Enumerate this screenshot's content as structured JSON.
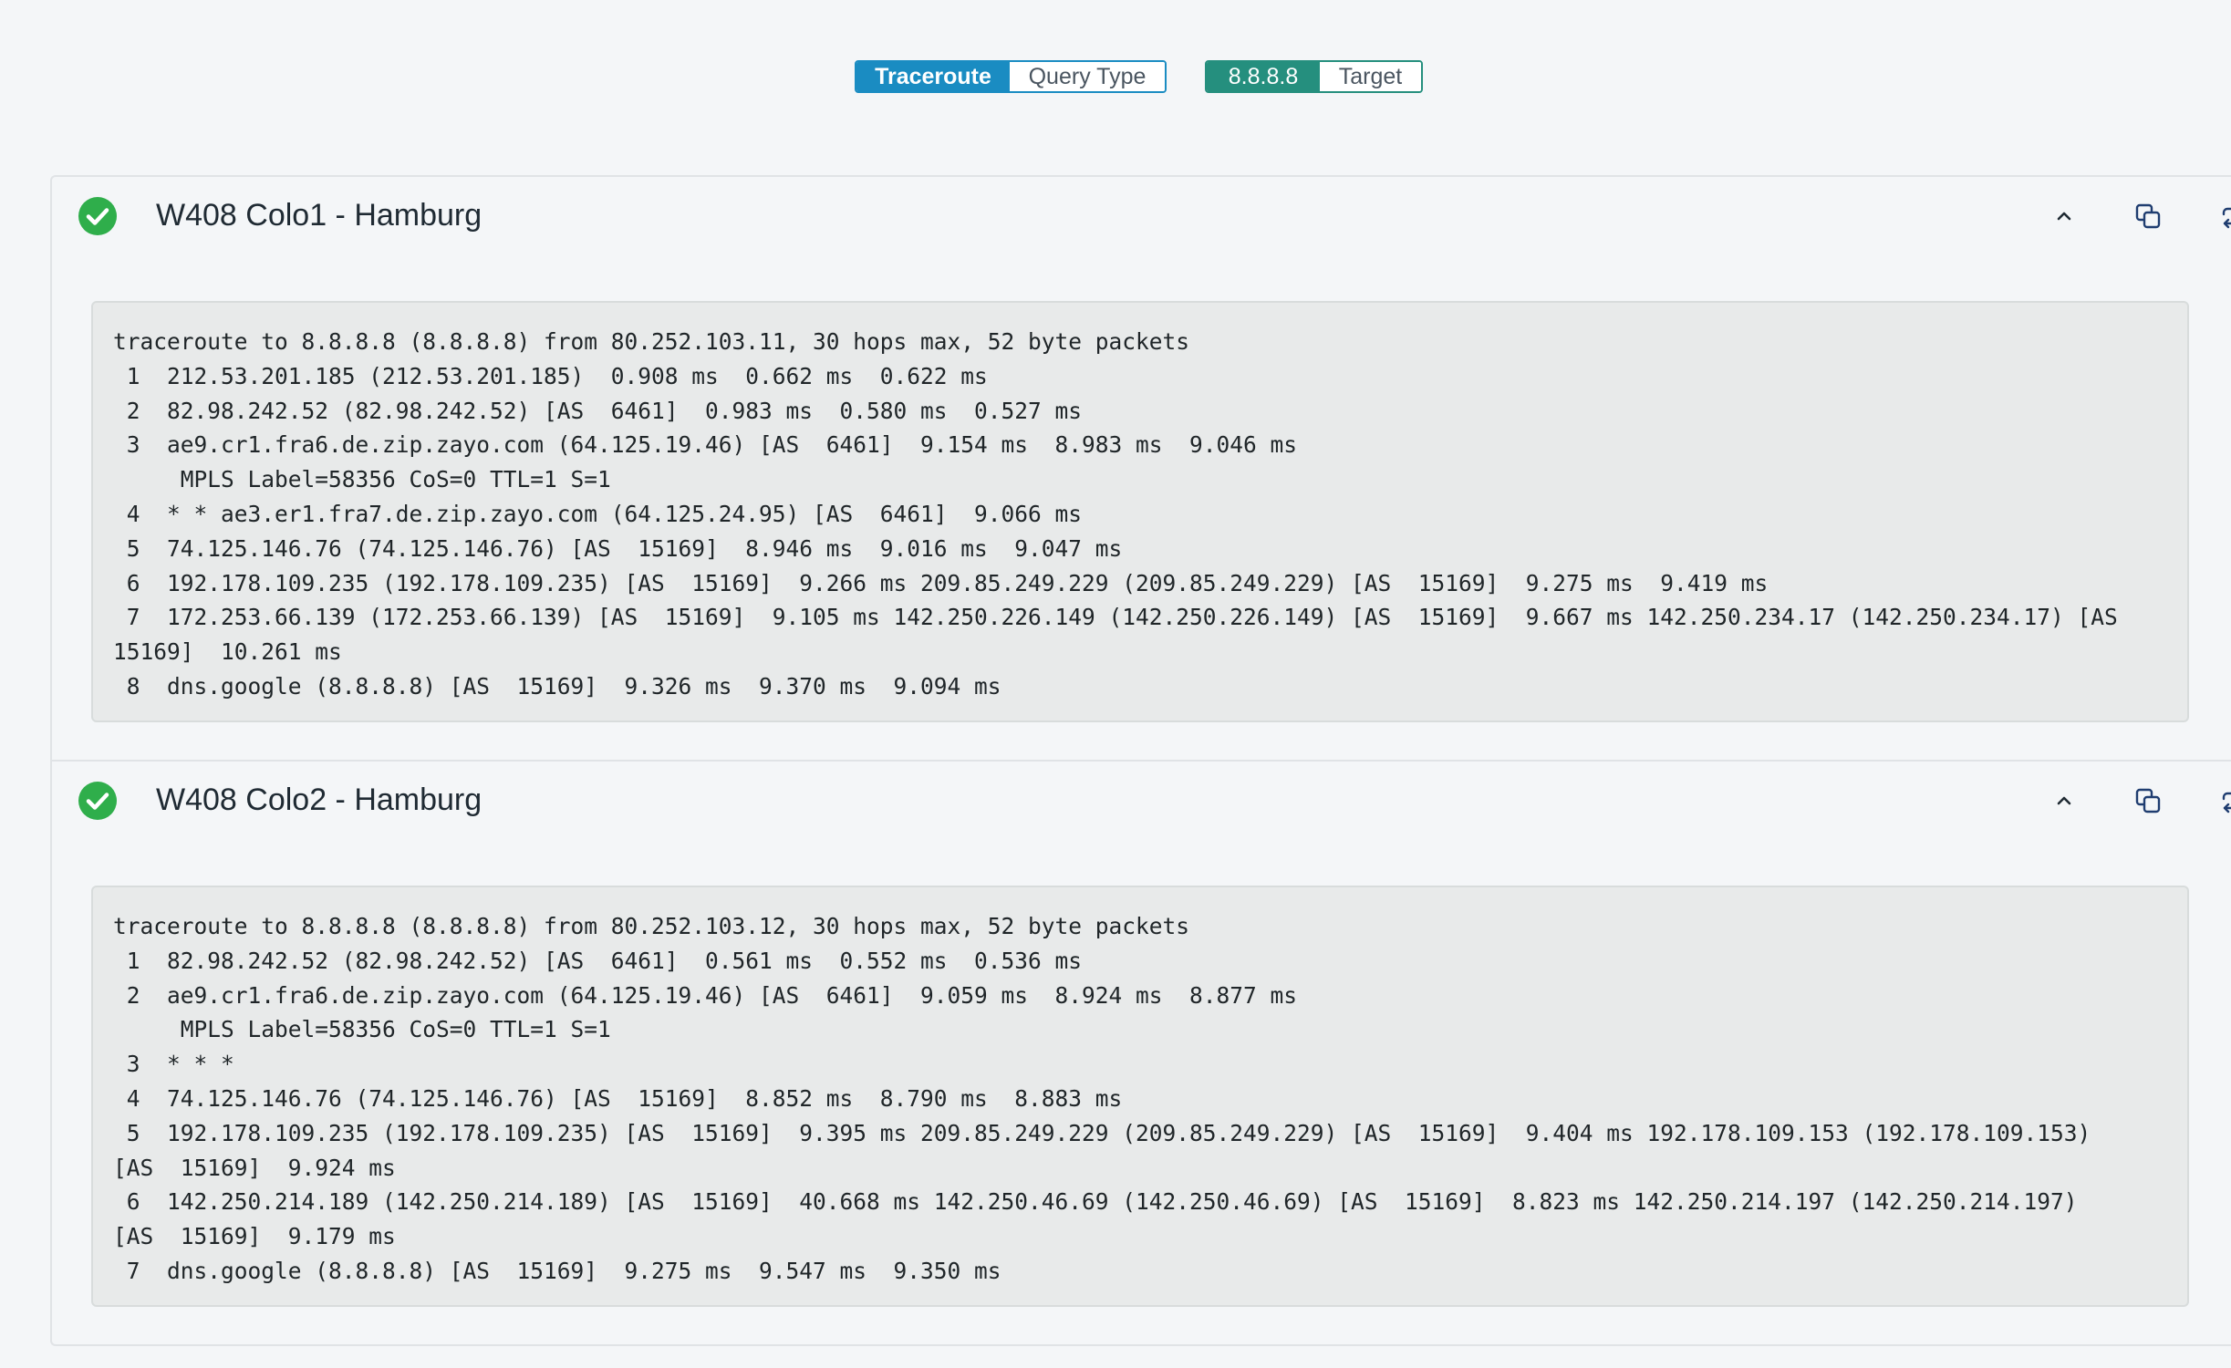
{
  "toolbar": {
    "query": {
      "value": "Traceroute",
      "label": "Query Type"
    },
    "target": {
      "value": "8.8.8.8",
      "label": "Target"
    }
  },
  "colors": {
    "query_accent": "#1a8cc2",
    "target_accent": "#258f7e",
    "success": "#2fae4b",
    "icon": "#1f3d70"
  },
  "results": [
    {
      "status": "success",
      "status_icon": "check-circle-icon",
      "title": "W408 Colo1 - Hamburg",
      "actions": [
        "chevron-up-icon",
        "copy-icon",
        "refresh-icon"
      ],
      "output": "traceroute to 8.8.8.8 (8.8.8.8) from 80.252.103.11, 30 hops max, 52 byte packets\n 1  212.53.201.185 (212.53.201.185)  0.908 ms  0.662 ms  0.622 ms\n 2  82.98.242.52 (82.98.242.52) [AS  6461]  0.983 ms  0.580 ms  0.527 ms\n 3  ae9.cr1.fra6.de.zip.zayo.com (64.125.19.46) [AS  6461]  9.154 ms  8.983 ms  9.046 ms\n     MPLS Label=58356 CoS=0 TTL=1 S=1\n 4  * * ae3.er1.fra7.de.zip.zayo.com (64.125.24.95) [AS  6461]  9.066 ms\n 5  74.125.146.76 (74.125.146.76) [AS  15169]  8.946 ms  9.016 ms  9.047 ms\n 6  192.178.109.235 (192.178.109.235) [AS  15169]  9.266 ms 209.85.249.229 (209.85.249.229) [AS  15169]  9.275 ms  9.419 ms\n 7  172.253.66.139 (172.253.66.139) [AS  15169]  9.105 ms 142.250.226.149 (142.250.226.149) [AS  15169]  9.667 ms 142.250.234.17 (142.250.234.17) [AS\n15169]  10.261 ms\n 8  dns.google (8.8.8.8) [AS  15169]  9.326 ms  9.370 ms  9.094 ms"
    },
    {
      "status": "success",
      "status_icon": "check-circle-icon",
      "title": "W408 Colo2 - Hamburg",
      "actions": [
        "chevron-up-icon",
        "copy-icon",
        "refresh-icon"
      ],
      "output": "traceroute to 8.8.8.8 (8.8.8.8) from 80.252.103.12, 30 hops max, 52 byte packets\n 1  82.98.242.52 (82.98.242.52) [AS  6461]  0.561 ms  0.552 ms  0.536 ms\n 2  ae9.cr1.fra6.de.zip.zayo.com (64.125.19.46) [AS  6461]  9.059 ms  8.924 ms  8.877 ms\n     MPLS Label=58356 CoS=0 TTL=1 S=1\n 3  * * *\n 4  74.125.146.76 (74.125.146.76) [AS  15169]  8.852 ms  8.790 ms  8.883 ms\n 5  192.178.109.235 (192.178.109.235) [AS  15169]  9.395 ms 209.85.249.229 (209.85.249.229) [AS  15169]  9.404 ms 192.178.109.153 (192.178.109.153)\n[AS  15169]  9.924 ms\n 6  142.250.214.189 (142.250.214.189) [AS  15169]  40.668 ms 142.250.46.69 (142.250.46.69) [AS  15169]  8.823 ms 142.250.214.197 (142.250.214.197)\n[AS  15169]  9.179 ms\n 7  dns.google (8.8.8.8) [AS  15169]  9.275 ms  9.547 ms  9.350 ms"
    }
  ]
}
